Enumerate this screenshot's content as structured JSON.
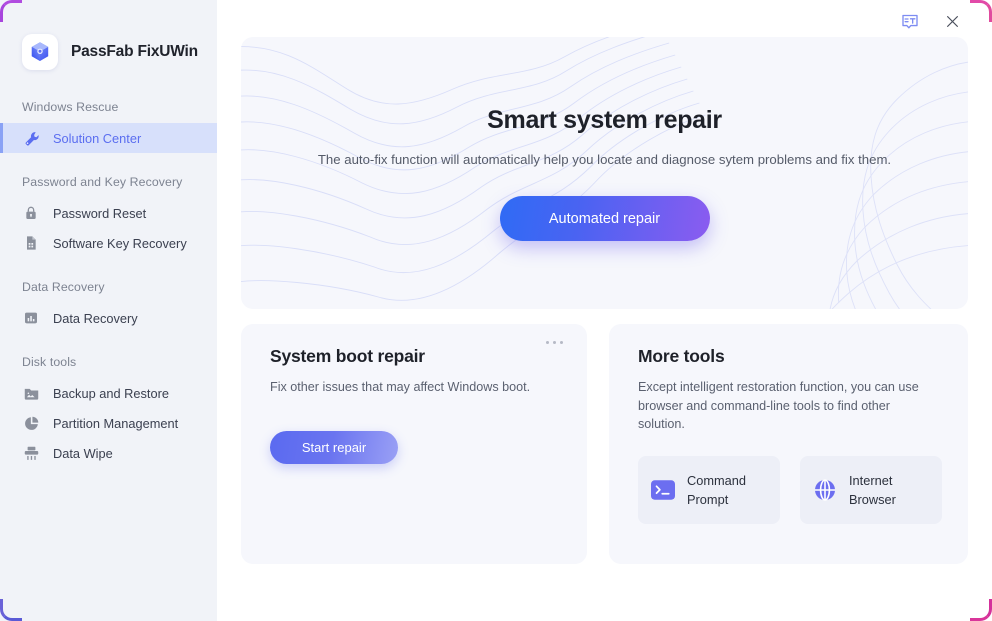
{
  "app": {
    "brand_name": "PassFab FixUWin",
    "logo_icon": "passfab-hexagon-logo"
  },
  "titlebar": {
    "language_icon": "language-translate-icon",
    "close_icon": "close-icon"
  },
  "sidebar": {
    "sections": [
      {
        "label": "Windows Rescue",
        "items": [
          {
            "label": "Solution Center",
            "icon": "wrench-icon",
            "active": true
          }
        ]
      },
      {
        "label": "Password and Key Recovery",
        "items": [
          {
            "label": "Password Reset",
            "icon": "lock-icon",
            "active": false
          },
          {
            "label": "Software Key Recovery",
            "icon": "document-key-icon",
            "active": false
          }
        ]
      },
      {
        "label": "Data Recovery",
        "items": [
          {
            "label": "Data Recovery",
            "icon": "bar-chart-icon",
            "active": false
          }
        ]
      },
      {
        "label": "Disk tools",
        "items": [
          {
            "label": "Backup and Restore",
            "icon": "folder-image-icon",
            "active": false
          },
          {
            "label": "Partition Management",
            "icon": "pie-chart-icon",
            "active": false
          },
          {
            "label": "Data Wipe",
            "icon": "shredder-icon",
            "active": false
          }
        ]
      }
    ]
  },
  "hero": {
    "title": "Smart system repair",
    "subtitle": "The auto-fix function will automatically help you locate and diagnose sytem problems and fix them.",
    "button_label": "Automated repair"
  },
  "cards": {
    "boot_repair": {
      "title": "System boot repair",
      "description": "Fix other issues that may affect Windows boot.",
      "button_label": "Start repair",
      "menu_icon": "more-options-icon"
    },
    "more_tools": {
      "title": "More tools",
      "description": "Except intelligent restoration function, you can use browser and command-line tools to find other solution.",
      "tools": [
        {
          "label": "Command Prompt",
          "icon": "command-prompt-icon"
        },
        {
          "label": "Internet Browser",
          "icon": "globe-icon"
        }
      ]
    }
  },
  "colors": {
    "accent_blue": "#5b6ef0",
    "accent_purple": "#8b5cf0",
    "sidebar_bg": "#f1f3f8",
    "card_bg": "#f6f7fc",
    "active_item_bg": "#d7e0fb"
  }
}
